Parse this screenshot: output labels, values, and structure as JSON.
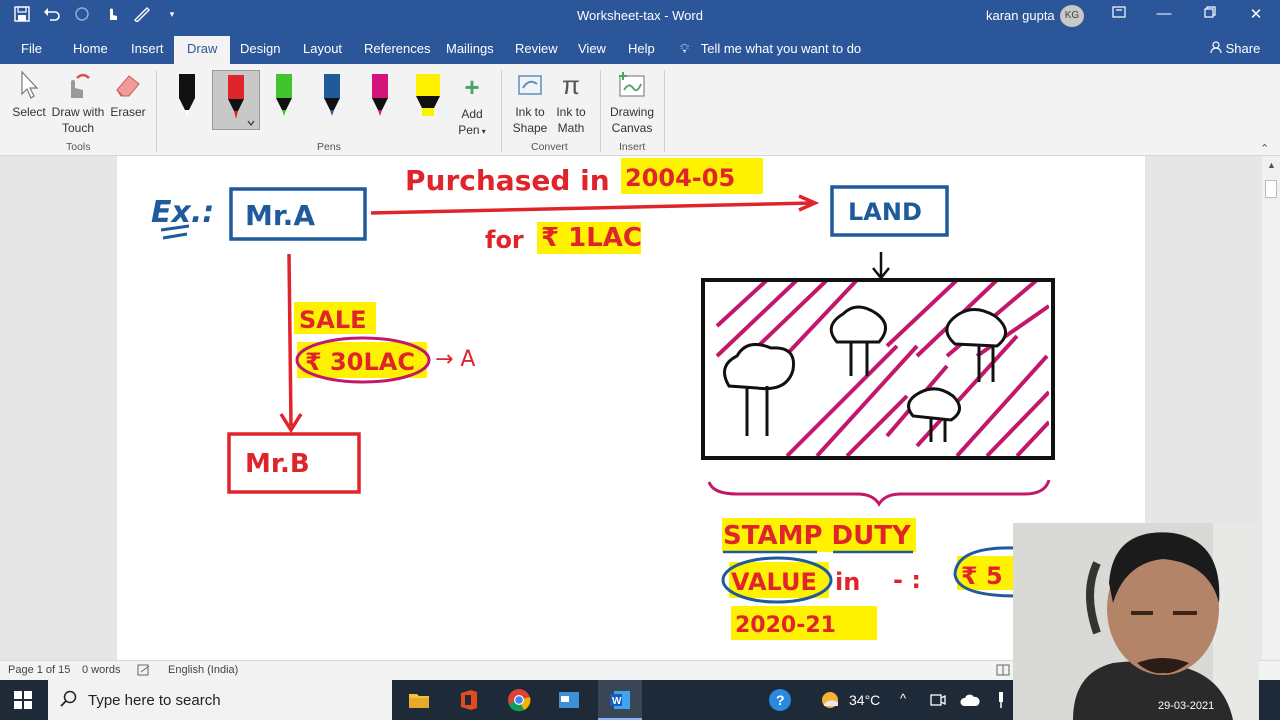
{
  "window": {
    "title": "Worksheet-tax  -  Word",
    "user_name": "karan gupta",
    "user_initials": "KG"
  },
  "tabs": [
    "File",
    "Home",
    "Insert",
    "Draw",
    "Design",
    "Layout",
    "References",
    "Mailings",
    "Review",
    "View",
    "Help"
  ],
  "active_tab": "Draw",
  "tell_me": "Tell me what you want to do",
  "share": "Share",
  "ribbon": {
    "tools": {
      "select": "Select",
      "draw_touch_1": "Draw with",
      "draw_touch_2": "Touch",
      "eraser": "Eraser",
      "label": "Tools"
    },
    "pens": {
      "add_pen_1": "Add",
      "add_pen_2": "Pen",
      "label": "Pens"
    },
    "convert": {
      "ink_shape_1": "Ink to",
      "ink_shape_2": "Shape",
      "ink_math_1": "Ink to",
      "ink_math_2": "Math",
      "label": "Convert"
    },
    "insert": {
      "canvas_1": "Drawing",
      "canvas_2": "Canvas",
      "label": "Insert"
    }
  },
  "ink": {
    "ex": "Ex.:",
    "mr_a": "Mr.A",
    "purchased": "Purchased in",
    "year": "2004-05",
    "for_text": "for",
    "amount": "₹ 1LAC",
    "land": "LAND",
    "sale": "SALE",
    "sale_amount": "₹ 30LAC",
    "arrow_a": "→ A",
    "mr_b": "Mr.B",
    "stamp_duty": "STAMP DUTY",
    "value": "VALUE",
    "in_text": "in",
    "dash": "- :",
    "value_amount": "₹ 5",
    "year2": "2020-21"
  },
  "statusbar": {
    "page": "Page 1 of 15",
    "words": "0 words",
    "language": "English (India)"
  },
  "taskbar": {
    "search": "Type here to search",
    "temperature": "34°C",
    "date": "29-03-2021"
  },
  "colors": {
    "word_blue": "#2b579a",
    "ink_red": "#e0242c",
    "ink_blue": "#1f5a9c",
    "ink_magenta": "#c2186b",
    "highlight": "#fff200"
  }
}
